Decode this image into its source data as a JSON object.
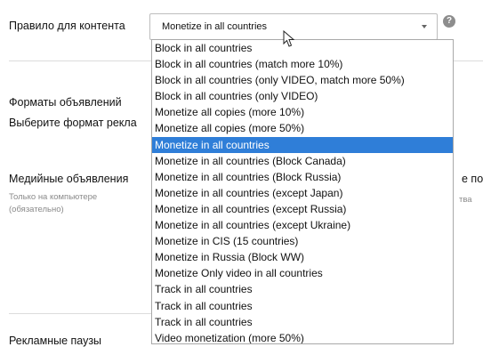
{
  "rule": {
    "label": "Правило для контента",
    "selected_value": "Monetize in all countries",
    "help_icon": "help-icon",
    "help_glyph": "?"
  },
  "dropdown": {
    "options": [
      "Block in all countries",
      "Block in all countries (match more 10%)",
      "Block in all countries (only VIDEO, match more 50%)",
      "Block in all countries (only VIDEO)",
      "Monetize all copies (more 10%)",
      "Monetize all copies (more 50%)",
      "Monetize in all countries",
      "Monetize in all countries (Block Canada)",
      "Monetize in all countries (Block Russia)",
      "Monetize in all countries (except Japan)",
      "Monetize in all countries (except Russia)",
      "Monetize in all countries (except Ukraine)",
      "Monetize in CIS (15 countries)",
      "Monetize in Russia (Block WW)",
      "Monetize Only video in all countries",
      "Track in all countries",
      "Track in all countries",
      "Track in all countries",
      "Video monetization (more 50%)"
    ],
    "selected_index": 6,
    "highlight_color": "#2f7ed8"
  },
  "ad_formats": {
    "title": "Форматы объявлений",
    "subtitle": "Выберите формат рекла"
  },
  "media_ads": {
    "label": "Медийные объявления",
    "note_line1": "Только на компьютере",
    "note_line2": "(обязательно)",
    "right_partial": "е по",
    "right_note_partial": "тва"
  },
  "ad_breaks": {
    "label": "Рекламные паузы"
  }
}
